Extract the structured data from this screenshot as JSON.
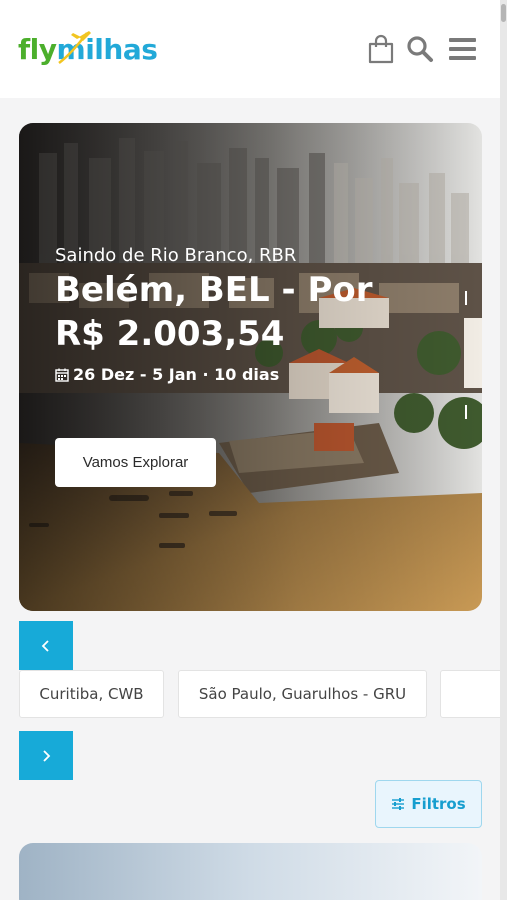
{
  "header": {
    "logo_fly": "fly",
    "logo_milhas": "milhas",
    "icons": [
      "shopping-bag-icon",
      "search-icon",
      "hamburger-menu-icon"
    ]
  },
  "hero": {
    "origin": "Saindo de Rio Branco, RBR",
    "destination": "Belém, BEL - Por",
    "price": "R$ 2.003,54",
    "dates": "26 Dez - 5 Jan · 10 dias",
    "cta": "Vamos Explorar"
  },
  "carousel": {
    "prev_icon": "chevron-left-icon",
    "next_icon": "chevron-right-icon",
    "chips": [
      "Curitiba, CWB",
      "São Paulo, Guarulhos - GRU",
      ""
    ]
  },
  "filters": {
    "label": "Filtros",
    "icon": "sliders-icon"
  },
  "colors": {
    "accent": "#17aad8",
    "logo_green": "#4caf2c",
    "logo_blue": "#22a9d8"
  }
}
